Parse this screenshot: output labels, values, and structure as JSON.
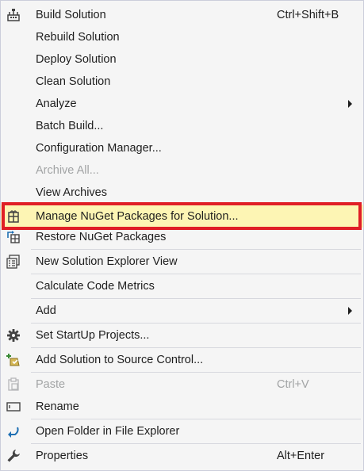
{
  "menu": {
    "items": [
      {
        "label": "Build Solution",
        "shortcut": "Ctrl+Shift+B",
        "icon": "build-solution-icon"
      },
      {
        "label": "Rebuild Solution"
      },
      {
        "label": "Deploy Solution"
      },
      {
        "label": "Clean Solution"
      },
      {
        "label": "Analyze",
        "submenu": true
      },
      {
        "label": "Batch Build..."
      },
      {
        "label": "Configuration Manager..."
      },
      {
        "label": "Archive All...",
        "disabled": true
      },
      {
        "label": "View Archives"
      },
      {
        "label": "Manage NuGet Packages for Solution...",
        "icon": "nuget-package-icon",
        "highlighted": true
      },
      {
        "label": "Restore NuGet Packages",
        "icon": "restore-packages-icon"
      },
      {
        "label": "New Solution Explorer View",
        "icon": "solution-explorer-view-icon"
      },
      {
        "label": "Calculate Code Metrics"
      },
      {
        "label": "Add",
        "submenu": true
      },
      {
        "label": "Set StartUp Projects...",
        "icon": "gear-icon"
      },
      {
        "label": "Add Solution to Source Control...",
        "icon": "source-control-add-icon"
      },
      {
        "label": "Paste",
        "shortcut": "Ctrl+V",
        "icon": "paste-icon",
        "disabled": true
      },
      {
        "label": "Rename",
        "icon": "rename-icon"
      },
      {
        "label": "Open Folder in File Explorer",
        "icon": "open-folder-arrow-icon"
      },
      {
        "label": "Properties",
        "shortcut": "Alt+Enter",
        "icon": "wrench-icon"
      }
    ]
  },
  "colors": {
    "highlight_bg": "#fdf5b4",
    "highlight_border": "#e01e26",
    "disabled_text": "#a2a4a5"
  }
}
